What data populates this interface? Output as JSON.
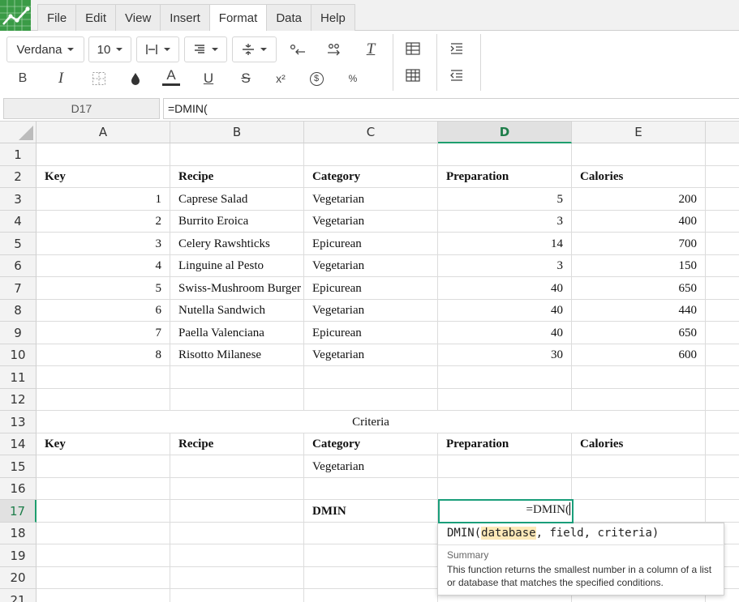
{
  "menubar": {
    "items": [
      "File",
      "Edit",
      "View",
      "Insert",
      "Format",
      "Data",
      "Help"
    ],
    "active": "Format"
  },
  "toolbar": {
    "font_name": "Verdana",
    "font_size": "10",
    "bold_label": "B",
    "italic_label": "I",
    "text_color_label": "A",
    "underline_label": "U",
    "strike_label": "S",
    "superscript_label": "x²",
    "currency_label": "$",
    "percent_label": "%",
    "clear_label": "T"
  },
  "formula_bar": {
    "cell_ref": "D17",
    "content": "=DMIN("
  },
  "sheet": {
    "columns": [
      "A",
      "B",
      "C",
      "D",
      "E"
    ],
    "selected_column": "D",
    "rows": [
      {
        "num": "1",
        "cells": [
          "",
          "",
          "",
          "",
          ""
        ]
      },
      {
        "num": "2",
        "cells": [
          "Key",
          "Recipe",
          "Category",
          "Preparation",
          "Calories"
        ]
      },
      {
        "num": "3",
        "cells": [
          "1",
          "Caprese Salad",
          "Vegetarian",
          "5",
          "200"
        ]
      },
      {
        "num": "4",
        "cells": [
          "2",
          "Burrito Eroica",
          "Vegetarian",
          "3",
          "400"
        ]
      },
      {
        "num": "5",
        "cells": [
          "3",
          "Celery Rawshticks",
          "Epicurean",
          "14",
          "700"
        ]
      },
      {
        "num": "6",
        "cells": [
          "4",
          "Linguine al Pesto",
          "Vegetarian",
          "3",
          "150"
        ]
      },
      {
        "num": "7",
        "cells": [
          "5",
          "Swiss-Mushroom Burger",
          "Epicurean",
          "40",
          "650"
        ]
      },
      {
        "num": "8",
        "cells": [
          "6",
          "Nutella Sandwich",
          "Vegetarian",
          "40",
          "440"
        ]
      },
      {
        "num": "9",
        "cells": [
          "7",
          "Paella Valenciana",
          "Epicurean",
          "40",
          "650"
        ]
      },
      {
        "num": "10",
        "cells": [
          "8",
          "Risotto Milanese",
          "Vegetarian",
          "30",
          "600"
        ]
      },
      {
        "num": "11",
        "cells": [
          "",
          "",
          "",
          "",
          ""
        ]
      },
      {
        "num": "12",
        "cells": [
          "",
          "",
          "",
          "",
          ""
        ]
      },
      {
        "num": "13",
        "cells": [
          "",
          "",
          "Criteria",
          "",
          ""
        ]
      },
      {
        "num": "14",
        "cells": [
          "Key",
          "Recipe",
          "Category",
          "Preparation",
          "Calories"
        ]
      },
      {
        "num": "15",
        "cells": [
          "",
          "",
          "Vegetarian",
          "",
          ""
        ]
      },
      {
        "num": "16",
        "cells": [
          "",
          "",
          "",
          "",
          ""
        ]
      },
      {
        "num": "17",
        "cells": [
          "",
          "",
          "DMIN",
          "",
          ""
        ]
      },
      {
        "num": "18",
        "cells": [
          "",
          "",
          "",
          "",
          ""
        ]
      },
      {
        "num": "19",
        "cells": [
          "",
          "",
          "",
          "",
          ""
        ]
      },
      {
        "num": "20",
        "cells": [
          "",
          "",
          "",
          "",
          ""
        ]
      },
      {
        "num": "21",
        "cells": [
          "",
          "",
          "",
          "",
          ""
        ]
      }
    ],
    "active_cell": {
      "ref": "D17",
      "value": "=DMIN("
    }
  },
  "tooltip": {
    "fn_name": "DMIN(",
    "arg1": "database",
    "rest": ", field, criteria)",
    "heading": "Summary",
    "body": "This function returns the smallest number in a column of a list or database that matches the specified conditions."
  },
  "colors": {
    "logo": "#3a9b46",
    "selection": "#1a9e7a",
    "header_selected_text": "#1e7e4a"
  }
}
